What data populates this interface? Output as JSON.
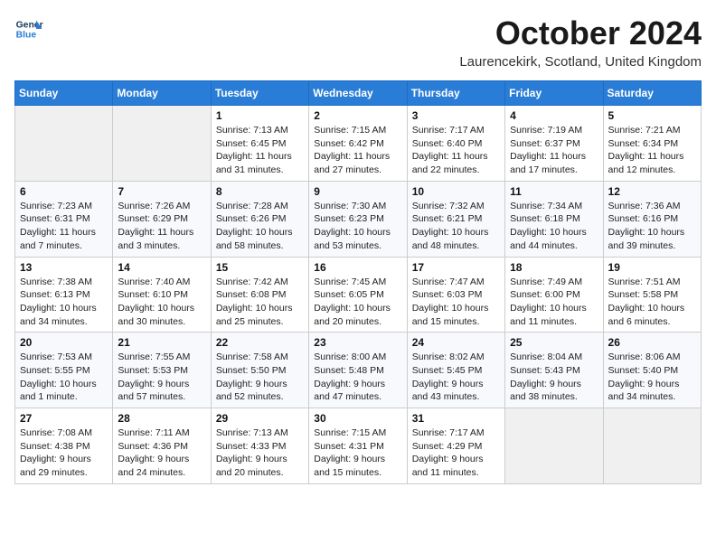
{
  "logo": {
    "line1": "General",
    "line2": "Blue"
  },
  "title": "October 2024",
  "subtitle": "Laurencekirk, Scotland, United Kingdom",
  "days_of_week": [
    "Sunday",
    "Monday",
    "Tuesday",
    "Wednesday",
    "Thursday",
    "Friday",
    "Saturday"
  ],
  "weeks": [
    [
      {
        "day": "",
        "info": ""
      },
      {
        "day": "",
        "info": ""
      },
      {
        "day": "1",
        "info": "Sunrise: 7:13 AM\nSunset: 6:45 PM\nDaylight: 11 hours and 31 minutes."
      },
      {
        "day": "2",
        "info": "Sunrise: 7:15 AM\nSunset: 6:42 PM\nDaylight: 11 hours and 27 minutes."
      },
      {
        "day": "3",
        "info": "Sunrise: 7:17 AM\nSunset: 6:40 PM\nDaylight: 11 hours and 22 minutes."
      },
      {
        "day": "4",
        "info": "Sunrise: 7:19 AM\nSunset: 6:37 PM\nDaylight: 11 hours and 17 minutes."
      },
      {
        "day": "5",
        "info": "Sunrise: 7:21 AM\nSunset: 6:34 PM\nDaylight: 11 hours and 12 minutes."
      }
    ],
    [
      {
        "day": "6",
        "info": "Sunrise: 7:23 AM\nSunset: 6:31 PM\nDaylight: 11 hours and 7 minutes."
      },
      {
        "day": "7",
        "info": "Sunrise: 7:26 AM\nSunset: 6:29 PM\nDaylight: 11 hours and 3 minutes."
      },
      {
        "day": "8",
        "info": "Sunrise: 7:28 AM\nSunset: 6:26 PM\nDaylight: 10 hours and 58 minutes."
      },
      {
        "day": "9",
        "info": "Sunrise: 7:30 AM\nSunset: 6:23 PM\nDaylight: 10 hours and 53 minutes."
      },
      {
        "day": "10",
        "info": "Sunrise: 7:32 AM\nSunset: 6:21 PM\nDaylight: 10 hours and 48 minutes."
      },
      {
        "day": "11",
        "info": "Sunrise: 7:34 AM\nSunset: 6:18 PM\nDaylight: 10 hours and 44 minutes."
      },
      {
        "day": "12",
        "info": "Sunrise: 7:36 AM\nSunset: 6:16 PM\nDaylight: 10 hours and 39 minutes."
      }
    ],
    [
      {
        "day": "13",
        "info": "Sunrise: 7:38 AM\nSunset: 6:13 PM\nDaylight: 10 hours and 34 minutes."
      },
      {
        "day": "14",
        "info": "Sunrise: 7:40 AM\nSunset: 6:10 PM\nDaylight: 10 hours and 30 minutes."
      },
      {
        "day": "15",
        "info": "Sunrise: 7:42 AM\nSunset: 6:08 PM\nDaylight: 10 hours and 25 minutes."
      },
      {
        "day": "16",
        "info": "Sunrise: 7:45 AM\nSunset: 6:05 PM\nDaylight: 10 hours and 20 minutes."
      },
      {
        "day": "17",
        "info": "Sunrise: 7:47 AM\nSunset: 6:03 PM\nDaylight: 10 hours and 15 minutes."
      },
      {
        "day": "18",
        "info": "Sunrise: 7:49 AM\nSunset: 6:00 PM\nDaylight: 10 hours and 11 minutes."
      },
      {
        "day": "19",
        "info": "Sunrise: 7:51 AM\nSunset: 5:58 PM\nDaylight: 10 hours and 6 minutes."
      }
    ],
    [
      {
        "day": "20",
        "info": "Sunrise: 7:53 AM\nSunset: 5:55 PM\nDaylight: 10 hours and 1 minute."
      },
      {
        "day": "21",
        "info": "Sunrise: 7:55 AM\nSunset: 5:53 PM\nDaylight: 9 hours and 57 minutes."
      },
      {
        "day": "22",
        "info": "Sunrise: 7:58 AM\nSunset: 5:50 PM\nDaylight: 9 hours and 52 minutes."
      },
      {
        "day": "23",
        "info": "Sunrise: 8:00 AM\nSunset: 5:48 PM\nDaylight: 9 hours and 47 minutes."
      },
      {
        "day": "24",
        "info": "Sunrise: 8:02 AM\nSunset: 5:45 PM\nDaylight: 9 hours and 43 minutes."
      },
      {
        "day": "25",
        "info": "Sunrise: 8:04 AM\nSunset: 5:43 PM\nDaylight: 9 hours and 38 minutes."
      },
      {
        "day": "26",
        "info": "Sunrise: 8:06 AM\nSunset: 5:40 PM\nDaylight: 9 hours and 34 minutes."
      }
    ],
    [
      {
        "day": "27",
        "info": "Sunrise: 7:08 AM\nSunset: 4:38 PM\nDaylight: 9 hours and 29 minutes."
      },
      {
        "day": "28",
        "info": "Sunrise: 7:11 AM\nSunset: 4:36 PM\nDaylight: 9 hours and 24 minutes."
      },
      {
        "day": "29",
        "info": "Sunrise: 7:13 AM\nSunset: 4:33 PM\nDaylight: 9 hours and 20 minutes."
      },
      {
        "day": "30",
        "info": "Sunrise: 7:15 AM\nSunset: 4:31 PM\nDaylight: 9 hours and 15 minutes."
      },
      {
        "day": "31",
        "info": "Sunrise: 7:17 AM\nSunset: 4:29 PM\nDaylight: 9 hours and 11 minutes."
      },
      {
        "day": "",
        "info": ""
      },
      {
        "day": "",
        "info": ""
      }
    ]
  ]
}
